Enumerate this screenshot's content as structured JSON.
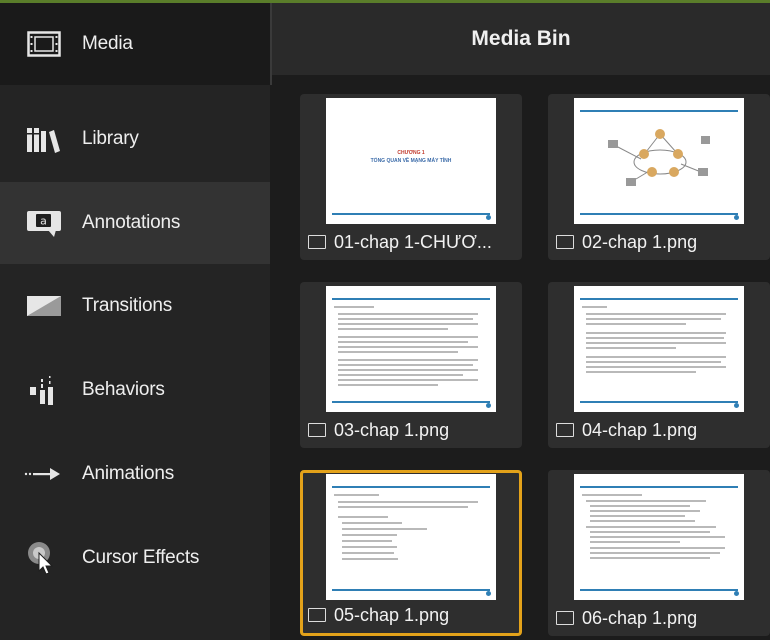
{
  "sidebar": {
    "items": [
      {
        "label": "Media",
        "icon": "film-strip-icon",
        "state": "active"
      },
      {
        "label": "Library",
        "icon": "library-books-icon"
      },
      {
        "label": "Annotations",
        "icon": "annotation-callout-icon",
        "state": "hover"
      },
      {
        "label": "Transitions",
        "icon": "transition-icon"
      },
      {
        "label": "Behaviors",
        "icon": "behaviors-icon"
      },
      {
        "label": "Animations",
        "icon": "animation-arrow-icon"
      },
      {
        "label": "Cursor Effects",
        "icon": "cursor-effects-icon"
      }
    ]
  },
  "media_bin": {
    "title": "Media Bin",
    "items": [
      {
        "label": "01-chap 1-CHƯƠ...",
        "thumb_heading": "CHƯƠNG 1",
        "thumb_subtitle": "TỔNG QUAN VỀ MẠNG MÁY TÍNH"
      },
      {
        "label": "02-chap 1.png"
      },
      {
        "label": "03-chap 1.png"
      },
      {
        "label": "04-chap 1.png"
      },
      {
        "label": "05-chap 1.png",
        "selected": true
      },
      {
        "label": "06-chap 1.png"
      }
    ]
  },
  "colors": {
    "selection": "#e3a21a",
    "accent_line": "#5a7d2a"
  }
}
